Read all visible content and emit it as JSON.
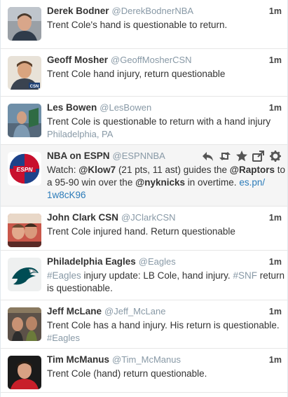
{
  "tweets": [
    {
      "name": "Derek Bodner",
      "handle": "@DerekBodnerNBA",
      "time": "1m",
      "text": "Trent Cole's hand is questionable to return."
    },
    {
      "name": "Geoff Mosher",
      "handle": "@GeoffMosherCSN",
      "time": "1m",
      "text": "Trent Cole hand injury, return questionable"
    },
    {
      "name": "Les Bowen",
      "handle": "@LesBowen",
      "time": "1m",
      "text": "Trent Cole is questionable to return with a hand injury",
      "location": "Philadelphia, PA"
    },
    {
      "name": "NBA on ESPN",
      "handle": "@ESPNNBA",
      "parts": {
        "p1": "Watch: ",
        "m1": "@Klow7",
        "p2": " (21 pts, 11 ast) guides the ",
        "m2": "@Raptors",
        "p3": " to",
        "p4": "a 95-90 win over the ",
        "m3": "@nyknicks",
        "p5": " in overtime.  ",
        "link1": "es.pn/",
        "link2": "1w8cK96"
      },
      "actions": [
        "reply-icon",
        "retweet-icon",
        "favorite-icon",
        "share-icon",
        "gear-icon"
      ]
    },
    {
      "name": "John Clark CSN",
      "handle": "@JClarkCSN",
      "time": "1m",
      "text": "Trent Cole injured hand. Return questionable"
    },
    {
      "name": "Philadelphia Eagles",
      "handle": "@Eagles",
      "time": "1m",
      "parts": {
        "h1": "#Eagles",
        "p1": " injury update: LB Cole, hand injury. ",
        "h2": "#SNF",
        "p2": " return",
        "p3": "is questionable."
      }
    },
    {
      "name": "Jeff McLane",
      "handle": "@Jeff_McLane",
      "time": "1m",
      "text": "Trent Cole has a hand injury. His return is questionable.",
      "hashtag": "#Eagles"
    },
    {
      "name": "Tim McManus",
      "handle": "@Tim_McManus",
      "time": "1m",
      "text": "Trent Cole (hand) return questionable."
    }
  ],
  "colors": {
    "name": "#333333",
    "handle": "#8899a6",
    "link": "#2b7bb9",
    "hover_bg": "#f5f5f5",
    "divider": "#e6e6e6"
  }
}
